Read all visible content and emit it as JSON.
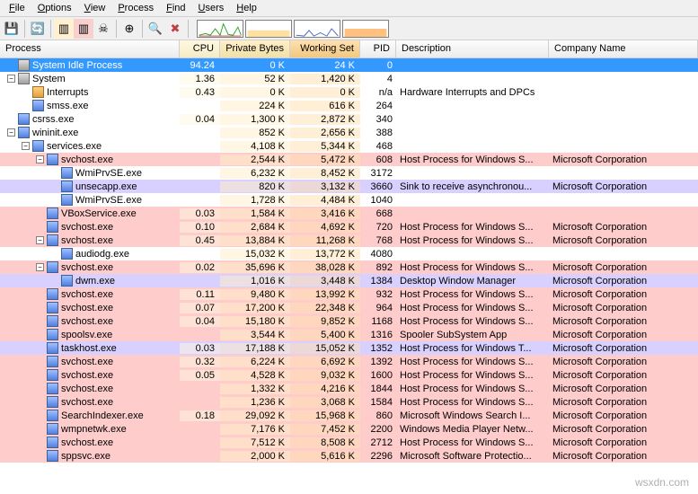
{
  "menu": [
    "File",
    "Options",
    "View",
    "Process",
    "Find",
    "Users",
    "Help"
  ],
  "columns": {
    "process": "Process",
    "cpu": "CPU",
    "priv": "Private Bytes",
    "work": "Working Set",
    "pid": "PID",
    "desc": "Description",
    "comp": "Company Name"
  },
  "rows": [
    {
      "depth": 0,
      "btn": "",
      "icon": "sys",
      "name": "System Idle Process",
      "cpu": "94.24",
      "priv": "0 K",
      "work": "24 K",
      "pid": "0",
      "desc": "",
      "comp": "",
      "cls": "sel"
    },
    {
      "depth": 0,
      "btn": "-",
      "icon": "sys",
      "name": "System",
      "cpu": "1.36",
      "priv": "52 K",
      "work": "1,420 K",
      "pid": "4",
      "desc": "",
      "comp": "",
      "cls": ""
    },
    {
      "depth": 1,
      "btn": "",
      "icon": "int",
      "name": "Interrupts",
      "cpu": "0.43",
      "priv": "0 K",
      "work": "0 K",
      "pid": "n/a",
      "desc": "Hardware Interrupts and DPCs",
      "comp": "",
      "cls": ""
    },
    {
      "depth": 1,
      "btn": "",
      "icon": "app",
      "name": "smss.exe",
      "cpu": "",
      "priv": "224 K",
      "work": "616 K",
      "pid": "264",
      "desc": "",
      "comp": "",
      "cls": ""
    },
    {
      "depth": 0,
      "btn": "",
      "icon": "app",
      "name": "csrss.exe",
      "cpu": "0.04",
      "priv": "1,300 K",
      "work": "2,872 K",
      "pid": "340",
      "desc": "",
      "comp": "",
      "cls": ""
    },
    {
      "depth": 0,
      "btn": "-",
      "icon": "app",
      "name": "wininit.exe",
      "cpu": "",
      "priv": "852 K",
      "work": "2,656 K",
      "pid": "388",
      "desc": "",
      "comp": "",
      "cls": ""
    },
    {
      "depth": 1,
      "btn": "-",
      "icon": "app",
      "name": "services.exe",
      "cpu": "",
      "priv": "4,108 K",
      "work": "5,344 K",
      "pid": "468",
      "desc": "",
      "comp": "",
      "cls": ""
    },
    {
      "depth": 2,
      "btn": "-",
      "icon": "app",
      "name": "svchost.exe",
      "cpu": "",
      "priv": "2,544 K",
      "work": "5,472 K",
      "pid": "608",
      "desc": "Host Process for Windows S...",
      "comp": "Microsoft Corporation",
      "cls": "pink"
    },
    {
      "depth": 3,
      "btn": "",
      "icon": "app",
      "name": "WmiPrvSE.exe",
      "cpu": "",
      "priv": "6,232 K",
      "work": "8,452 K",
      "pid": "3172",
      "desc": "",
      "comp": "",
      "cls": ""
    },
    {
      "depth": 3,
      "btn": "",
      "icon": "app",
      "name": "unsecapp.exe",
      "cpu": "",
      "priv": "820 K",
      "work": "3,132 K",
      "pid": "3660",
      "desc": "Sink to receive asynchronou...",
      "comp": "Microsoft Corporation",
      "cls": "purple"
    },
    {
      "depth": 3,
      "btn": "",
      "icon": "app",
      "name": "WmiPrvSE.exe",
      "cpu": "",
      "priv": "1,728 K",
      "work": "4,484 K",
      "pid": "1040",
      "desc": "",
      "comp": "",
      "cls": ""
    },
    {
      "depth": 2,
      "btn": "",
      "icon": "app",
      "name": "VBoxService.exe",
      "cpu": "0.03",
      "priv": "1,584 K",
      "work": "3,416 K",
      "pid": "668",
      "desc": "",
      "comp": "",
      "cls": "pink"
    },
    {
      "depth": 2,
      "btn": "",
      "icon": "app",
      "name": "svchost.exe",
      "cpu": "0.10",
      "priv": "2,684 K",
      "work": "4,692 K",
      "pid": "720",
      "desc": "Host Process for Windows S...",
      "comp": "Microsoft Corporation",
      "cls": "pink"
    },
    {
      "depth": 2,
      "btn": "-",
      "icon": "app",
      "name": "svchost.exe",
      "cpu": "0.45",
      "priv": "13,884 K",
      "work": "11,268 K",
      "pid": "768",
      "desc": "Host Process for Windows S...",
      "comp": "Microsoft Corporation",
      "cls": "pink"
    },
    {
      "depth": 3,
      "btn": "",
      "icon": "app",
      "name": "audiodg.exe",
      "cpu": "",
      "priv": "15,032 K",
      "work": "13,772 K",
      "pid": "4080",
      "desc": "",
      "comp": "",
      "cls": ""
    },
    {
      "depth": 2,
      "btn": "-",
      "icon": "app",
      "name": "svchost.exe",
      "cpu": "0.02",
      "priv": "35,696 K",
      "work": "38,028 K",
      "pid": "892",
      "desc": "Host Process for Windows S...",
      "comp": "Microsoft Corporation",
      "cls": "pink"
    },
    {
      "depth": 3,
      "btn": "",
      "icon": "app",
      "name": "dwm.exe",
      "cpu": "",
      "priv": "1,016 K",
      "work": "3,448 K",
      "pid": "1384",
      "desc": "Desktop Window Manager",
      "comp": "Microsoft Corporation",
      "cls": "purple"
    },
    {
      "depth": 2,
      "btn": "",
      "icon": "app",
      "name": "svchost.exe",
      "cpu": "0.11",
      "priv": "9,480 K",
      "work": "13,992 K",
      "pid": "932",
      "desc": "Host Process for Windows S...",
      "comp": "Microsoft Corporation",
      "cls": "pink"
    },
    {
      "depth": 2,
      "btn": "",
      "icon": "app",
      "name": "svchost.exe",
      "cpu": "0.07",
      "priv": "17,200 K",
      "work": "22,348 K",
      "pid": "964",
      "desc": "Host Process for Windows S...",
      "comp": "Microsoft Corporation",
      "cls": "pink"
    },
    {
      "depth": 2,
      "btn": "",
      "icon": "app",
      "name": "svchost.exe",
      "cpu": "0.04",
      "priv": "15,180 K",
      "work": "9,852 K",
      "pid": "1168",
      "desc": "Host Process for Windows S...",
      "comp": "Microsoft Corporation",
      "cls": "pink"
    },
    {
      "depth": 2,
      "btn": "",
      "icon": "app",
      "name": "spoolsv.exe",
      "cpu": "",
      "priv": "3,544 K",
      "work": "5,400 K",
      "pid": "1316",
      "desc": "Spooler SubSystem App",
      "comp": "Microsoft Corporation",
      "cls": "pink"
    },
    {
      "depth": 2,
      "btn": "",
      "icon": "app",
      "name": "taskhost.exe",
      "cpu": "0.03",
      "priv": "17,188 K",
      "work": "15,052 K",
      "pid": "1352",
      "desc": "Host Process for Windows T...",
      "comp": "Microsoft Corporation",
      "cls": "purple"
    },
    {
      "depth": 2,
      "btn": "",
      "icon": "app",
      "name": "svchost.exe",
      "cpu": "0.32",
      "priv": "6,224 K",
      "work": "6,692 K",
      "pid": "1392",
      "desc": "Host Process for Windows S...",
      "comp": "Microsoft Corporation",
      "cls": "pink"
    },
    {
      "depth": 2,
      "btn": "",
      "icon": "app",
      "name": "svchost.exe",
      "cpu": "0.05",
      "priv": "4,528 K",
      "work": "9,032 K",
      "pid": "1600",
      "desc": "Host Process for Windows S...",
      "comp": "Microsoft Corporation",
      "cls": "pink"
    },
    {
      "depth": 2,
      "btn": "",
      "icon": "app",
      "name": "svchost.exe",
      "cpu": "",
      "priv": "1,332 K",
      "work": "4,216 K",
      "pid": "1844",
      "desc": "Host Process for Windows S...",
      "comp": "Microsoft Corporation",
      "cls": "pink"
    },
    {
      "depth": 2,
      "btn": "",
      "icon": "app",
      "name": "svchost.exe",
      "cpu": "",
      "priv": "1,236 K",
      "work": "3,068 K",
      "pid": "1584",
      "desc": "Host Process for Windows S...",
      "comp": "Microsoft Corporation",
      "cls": "pink"
    },
    {
      "depth": 2,
      "btn": "",
      "icon": "app",
      "name": "SearchIndexer.exe",
      "cpu": "0.18",
      "priv": "29,092 K",
      "work": "15,968 K",
      "pid": "860",
      "desc": "Microsoft Windows Search I...",
      "comp": "Microsoft Corporation",
      "cls": "pink"
    },
    {
      "depth": 2,
      "btn": "",
      "icon": "app",
      "name": "wmpnetwk.exe",
      "cpu": "",
      "priv": "7,176 K",
      "work": "7,452 K",
      "pid": "2200",
      "desc": "Windows Media Player Netw...",
      "comp": "Microsoft Corporation",
      "cls": "pink"
    },
    {
      "depth": 2,
      "btn": "",
      "icon": "app",
      "name": "svchost.exe",
      "cpu": "",
      "priv": "7,512 K",
      "work": "8,508 K",
      "pid": "2712",
      "desc": "Host Process for Windows S...",
      "comp": "Microsoft Corporation",
      "cls": "pink"
    },
    {
      "depth": 2,
      "btn": "",
      "icon": "app",
      "name": "sppsvc.exe",
      "cpu": "",
      "priv": "2,000 K",
      "work": "5,616 K",
      "pid": "2296",
      "desc": "Microsoft Software Protectio...",
      "comp": "Microsoft Corporation",
      "cls": "pink"
    }
  ],
  "watermark": "wsxdn.com"
}
